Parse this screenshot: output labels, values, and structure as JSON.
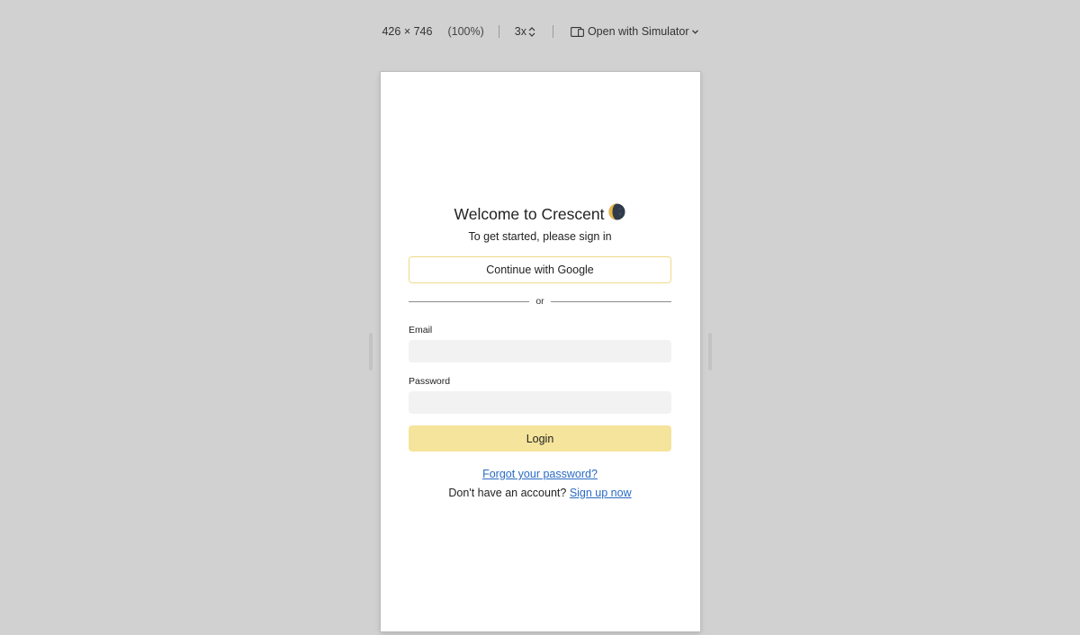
{
  "toolbar": {
    "dimensions": "426 × 746",
    "zoom": "(100%)",
    "scale": "3x",
    "open_with": "Open with Simulator",
    "icons": [
      "device-icon",
      "chevron-down-icon",
      "updown-chevron-icon"
    ]
  },
  "login": {
    "title": "Welcome to Crescent",
    "title_emoji": "moon-icon",
    "subtitle": "To get started, please sign in",
    "google_button": "Continue with Google",
    "divider_text": "or",
    "email_label": "Email",
    "email_value": "",
    "password_label": "Password",
    "password_value": "",
    "login_button": "Login",
    "forgot_link": "Forgot your password?",
    "no_account_text": "Don't have an account?",
    "signup_link": "Sign up now"
  },
  "colors": {
    "background": "#d1d1d1",
    "device": "#ffffff",
    "accent": "#f5e49b",
    "google_border": "#f0d98a",
    "link": "#2a6bc4",
    "input_bg": "#f2f2f2"
  }
}
